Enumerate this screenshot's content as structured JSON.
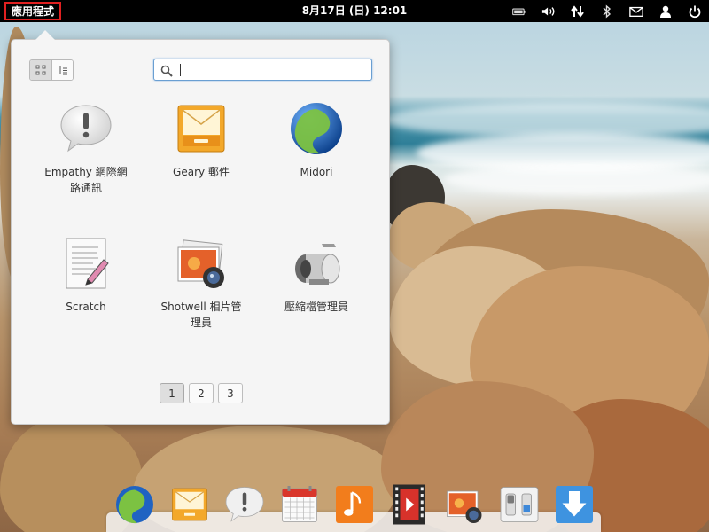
{
  "panel": {
    "applications_label": "應用程式",
    "clock": "8月17日 (日) 12:01",
    "indicators": [
      "battery-icon",
      "volume-icon",
      "network-icon",
      "bluetooth-icon",
      "mail-icon",
      "user-icon",
      "power-icon"
    ]
  },
  "launcher": {
    "view_modes": [
      "grid-view-icon",
      "category-view-icon"
    ],
    "active_view": "grid",
    "search": {
      "value": "",
      "placeholder": ""
    },
    "apps": [
      {
        "label": "Empathy 網際網路通訊",
        "icon": "empathy-icon"
      },
      {
        "label": "Geary 郵件",
        "icon": "geary-mail-icon"
      },
      {
        "label": "Midori",
        "icon": "midori-browser-icon"
      },
      {
        "label": "Scratch",
        "icon": "scratch-editor-icon"
      },
      {
        "label": "Shotwell 相片管理員",
        "icon": "shotwell-photos-icon"
      },
      {
        "label": "壓縮檔管理員",
        "icon": "archive-manager-icon"
      }
    ],
    "pages": [
      "1",
      "2",
      "3"
    ],
    "current_page": "1"
  },
  "dock": {
    "items": [
      "midori-browser-icon",
      "geary-mail-icon",
      "empathy-icon",
      "calendar-icon",
      "music-icon",
      "videos-icon",
      "shotwell-photos-icon",
      "settings-icon",
      "software-center-icon"
    ]
  }
}
